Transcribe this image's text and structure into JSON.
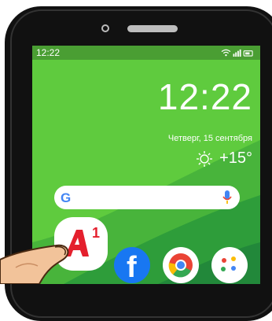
{
  "status_bar": {
    "time": "12:22"
  },
  "lockscreen": {
    "clock": "12:22",
    "date": "Четверг, 15 сентября",
    "temperature": "+15°",
    "weather_icon": "sun-icon"
  },
  "search_bar": {
    "logo": "G",
    "icon": "mic-icon"
  },
  "apps": [
    {
      "name": "A1",
      "label": "A1",
      "superscript": "1",
      "icon": "a1-logo-icon"
    },
    {
      "name": "Facebook",
      "icon": "facebook-icon",
      "glyph": "f"
    },
    {
      "name": "Chrome",
      "icon": "chrome-icon"
    },
    {
      "name": "Apps",
      "icon": "dots-icon"
    }
  ],
  "colors": {
    "wallpaper_light": "#5fcb3e",
    "wallpaper_dark": "#2e9d3a",
    "status_bar": "#4a9e33",
    "a1_red": "#e41f2d",
    "facebook_blue": "#1877f2"
  }
}
